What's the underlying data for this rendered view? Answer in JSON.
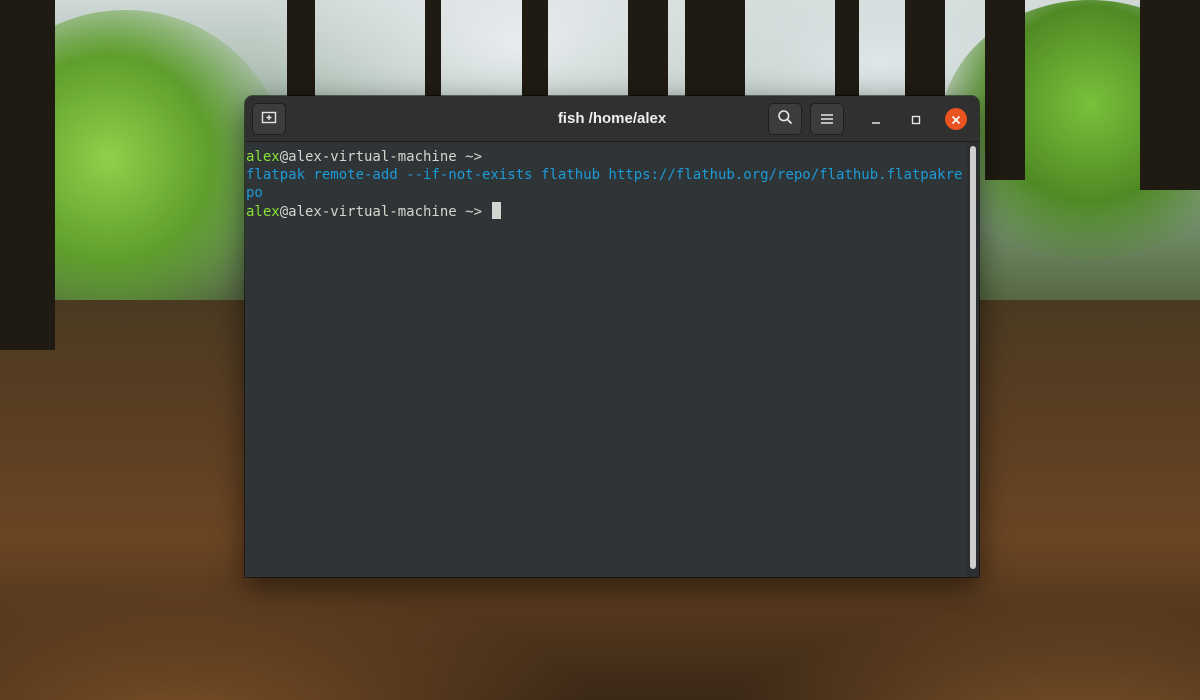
{
  "window": {
    "title": "fish /home/alex"
  },
  "titlebar": {
    "new_tab_icon": "new-tab-icon",
    "search_icon": "search-icon",
    "menu_icon": "hamburger-menu-icon",
    "minimize_icon": "minimize-icon",
    "maximize_icon": "maximize-icon",
    "close_icon": "close-icon"
  },
  "terminal": {
    "lines": [
      {
        "user": "alex",
        "host": "@alex-virtual-machine",
        "cwd": " ~> "
      },
      {
        "command": "flatpak remote-add --if-not-exists flathub https://flathub.org/repo/flathub.flatpakrepo"
      },
      {
        "user": "alex",
        "host": "@alex-virtual-machine",
        "cwd": " ~> "
      }
    ]
  },
  "colors": {
    "prompt_user": "#8ae234",
    "command": "#1d9bd7",
    "terminal_bg": "#2f3437",
    "close_button": "#e95420"
  }
}
